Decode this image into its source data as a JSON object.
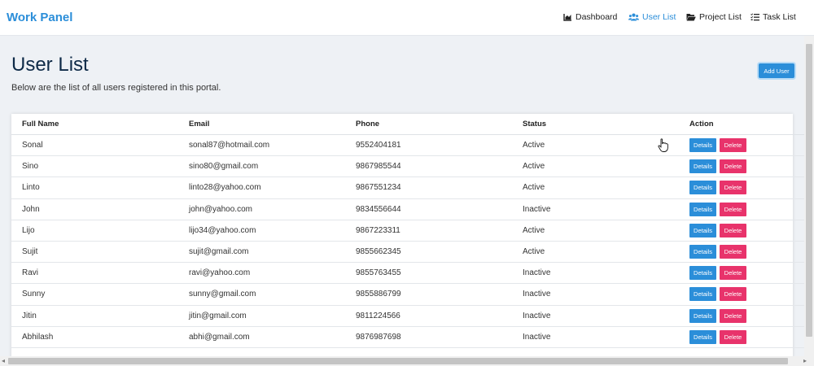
{
  "navbar": {
    "brand": "Work Panel",
    "items": [
      {
        "label": "Dashboard",
        "icon": "chart-area-icon",
        "active": false
      },
      {
        "label": "User List",
        "icon": "users-icon",
        "active": true
      },
      {
        "label": "Project List",
        "icon": "folder-open-icon",
        "active": false
      },
      {
        "label": "Task List",
        "icon": "tasks-icon",
        "active": false
      }
    ]
  },
  "page": {
    "title": "User List",
    "subtitle": "Below are the list of all users registered in this portal.",
    "add_user_label": "Add User"
  },
  "table": {
    "headers": [
      "Full Name",
      "Email",
      "Phone",
      "Status",
      "Action"
    ],
    "details_label": "Details",
    "delete_label": "Delete",
    "rows": [
      {
        "name": "Sonal",
        "email": "sonal87@hotmail.com",
        "phone": "9552404181",
        "status": "Active"
      },
      {
        "name": "Sino",
        "email": "sino80@gmail.com",
        "phone": "9867985544",
        "status": "Active"
      },
      {
        "name": "Linto",
        "email": "linto28@yahoo.com",
        "phone": "9867551234",
        "status": "Active"
      },
      {
        "name": "John",
        "email": "john@yahoo.com",
        "phone": "9834556644",
        "status": "Inactive"
      },
      {
        "name": "Lijo",
        "email": "lijo34@yahoo.com",
        "phone": "9867223311",
        "status": "Active"
      },
      {
        "name": "Sujit",
        "email": "sujit@gmail.com",
        "phone": "9855662345",
        "status": "Active"
      },
      {
        "name": "Ravi",
        "email": "ravi@yahoo.com",
        "phone": "9855763455",
        "status": "Inactive"
      },
      {
        "name": "Sunny",
        "email": "sunny@gmail.com",
        "phone": "9855886799",
        "status": "Inactive"
      },
      {
        "name": "Jitin",
        "email": "jitin@gmail.com",
        "phone": "9811224566",
        "status": "Inactive"
      },
      {
        "name": "Abhilash",
        "email": "abhi@gmail.com",
        "phone": "9876987698",
        "status": "Inactive"
      }
    ]
  },
  "colors": {
    "accent": "#2b8ed9",
    "danger": "#e8336b",
    "title": "#0e2a47",
    "background": "#eef1f5"
  }
}
